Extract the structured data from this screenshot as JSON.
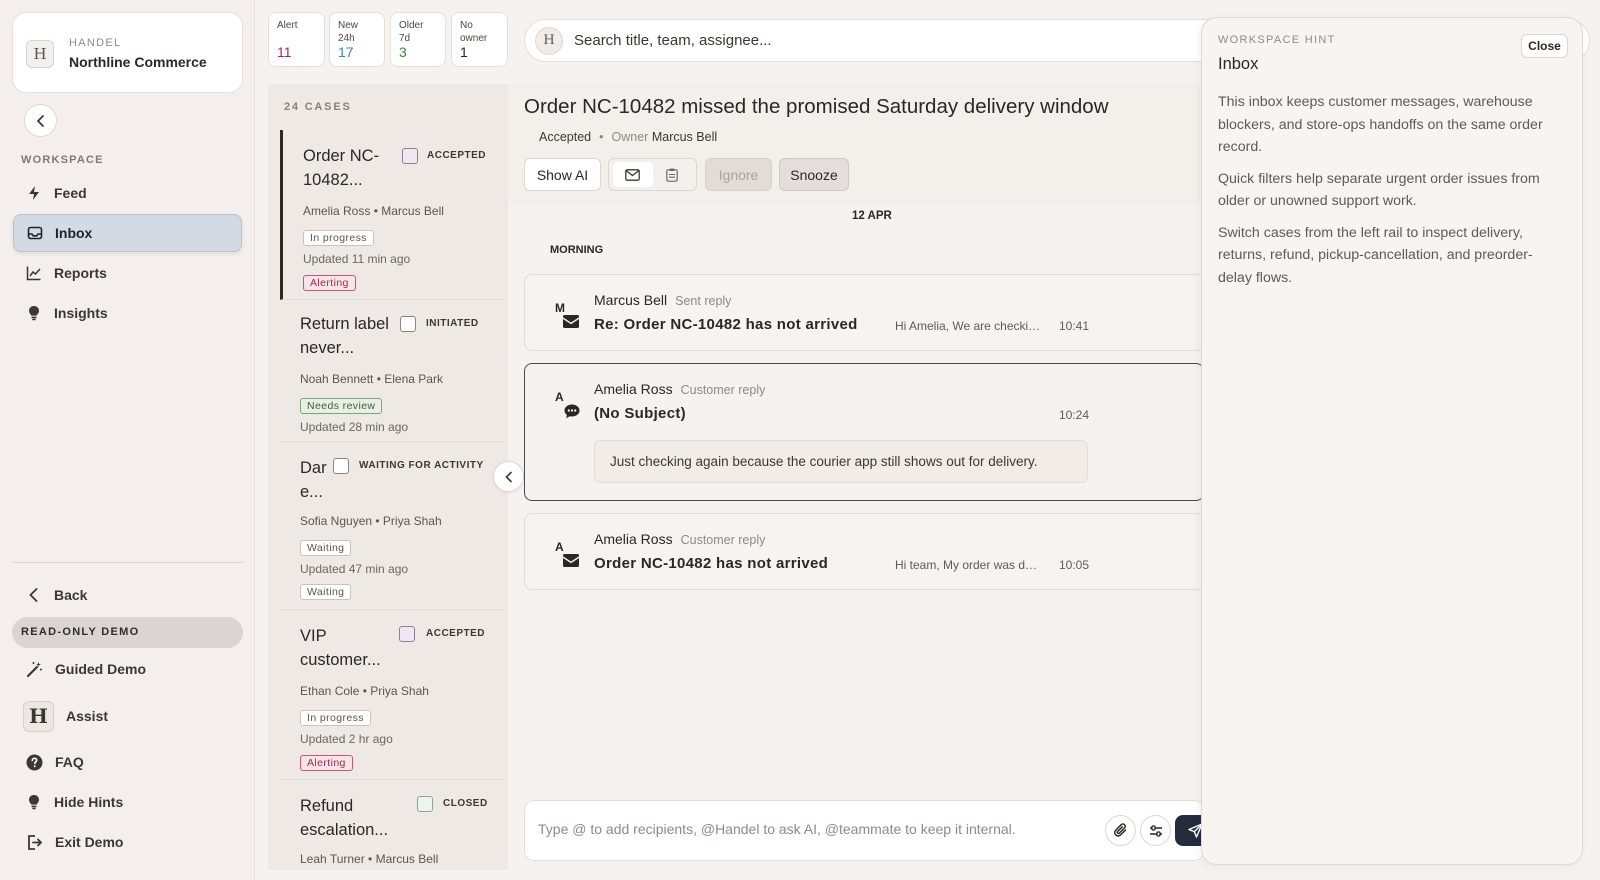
{
  "workspace": {
    "eyebrow": "HANDEL",
    "name": "Northline Commerce",
    "logo_letter": "H"
  },
  "nav": {
    "section_label": "WORKSPACE",
    "items": [
      {
        "label": "Feed",
        "icon": "bolt-icon"
      },
      {
        "label": "Inbox",
        "icon": "inbox-icon",
        "active": true
      },
      {
        "label": "Reports",
        "icon": "line-chart-icon"
      },
      {
        "label": "Insights",
        "icon": "lightbulb-icon"
      }
    ],
    "back_label": "Back",
    "demo_badge": "READ-ONLY DEMO",
    "bottom_items": [
      {
        "label": "Guided Demo",
        "icon": "magic-wand-icon"
      },
      {
        "label": "Assist",
        "icon": "handel-logo"
      },
      {
        "label": "FAQ",
        "icon": "question-circle-icon"
      },
      {
        "label": "Hide Hints",
        "icon": "lightbulb-icon"
      },
      {
        "label": "Exit Demo",
        "icon": "exit-icon"
      }
    ]
  },
  "stats": [
    {
      "label": "Alert",
      "value": "11",
      "color": "#b5244d"
    },
    {
      "label": "New 24h",
      "value": "17",
      "color": "#2f8fa0"
    },
    {
      "label": "Older 7d",
      "value": "3",
      "color": "#4f7d4a"
    },
    {
      "label": "No owner",
      "value": "1",
      "color": "#2a2725"
    }
  ],
  "search": {
    "placeholder": "Search title, team, assignee...",
    "logo_letter": "H"
  },
  "case_list": {
    "count_label": "24 CASES",
    "cases": [
      {
        "title": "Order NC-10482...",
        "status": "ACCEPTED",
        "people": "Amelia Ross • Marcus Bell",
        "tag": "In progress",
        "updated": "Updated 11 min ago",
        "alert": "Alerting"
      },
      {
        "title": "Return label never...",
        "status": "INITIATED",
        "people": "Noah Bennett • Elena Park",
        "tag": "Needs review",
        "updated": "Updated 28 min ago"
      },
      {
        "title": "Dar e...",
        "status": "WAITING FOR ACTIVITY",
        "people": "Sofia Nguyen • Priya Shah",
        "tag": "Waiting",
        "updated": "Updated 47 min ago",
        "tag2": "Waiting"
      },
      {
        "title": "VIP customer...",
        "status": "ACCEPTED",
        "people": "Ethan Cole • Priya Shah",
        "tag": "In progress",
        "updated": "Updated 2 hr ago",
        "alert": "Alerting"
      },
      {
        "title": "Refund escalation...",
        "status": "CLOSED",
        "people": "Leah Turner • Marcus Bell"
      }
    ]
  },
  "thread": {
    "title": "Order NC-10482 missed the promised Saturday delivery window",
    "status": "Accepted",
    "owner_label": "Owner",
    "owner": "Marcus Bell",
    "show_ai_label": "Show AI",
    "ignore_label": "Ignore",
    "snooze_label": "Snooze",
    "date_label": "12 APR",
    "period_label": "MORNING",
    "messages": [
      {
        "initial": "M",
        "author": "Marcus Bell",
        "kind": "Sent reply",
        "subject": "Re: Order NC-10482 has not arrived",
        "preview": "Hi Amelia, We are checking with the courier",
        "time": "10:41",
        "icon": "envelope-icon"
      },
      {
        "initial": "A",
        "author": "Amelia Ross",
        "kind": "Customer reply",
        "subject": "(No Subject)",
        "time": "10:24",
        "body": "Just checking again because the courier app still shows out for delivery.",
        "icon": "chat-bubble-icon"
      },
      {
        "initial": "A",
        "author": "Amelia Ross",
        "kind": "Customer reply",
        "subject": "Order NC-10482 has not arrived",
        "preview": "Hi team, My order was due Saturday",
        "time": "10:05",
        "icon": "envelope-icon"
      }
    ],
    "composer_placeholder": "Type @ to add recipients, @Handel to ask AI, @teammate to keep it internal."
  },
  "hint": {
    "eyebrow": "WORKSPACE HINT",
    "title": "Inbox",
    "close_label": "Close",
    "paragraphs": [
      "This inbox keeps customer messages, warehouse blockers, and store-ops handoffs on the same order record.",
      "Quick filters help separate urgent order issues from older or unowned support work.",
      "Switch cases from the left rail to inspect delivery, returns, refund, pickup-cancellation, and preorder-delay flows."
    ]
  }
}
